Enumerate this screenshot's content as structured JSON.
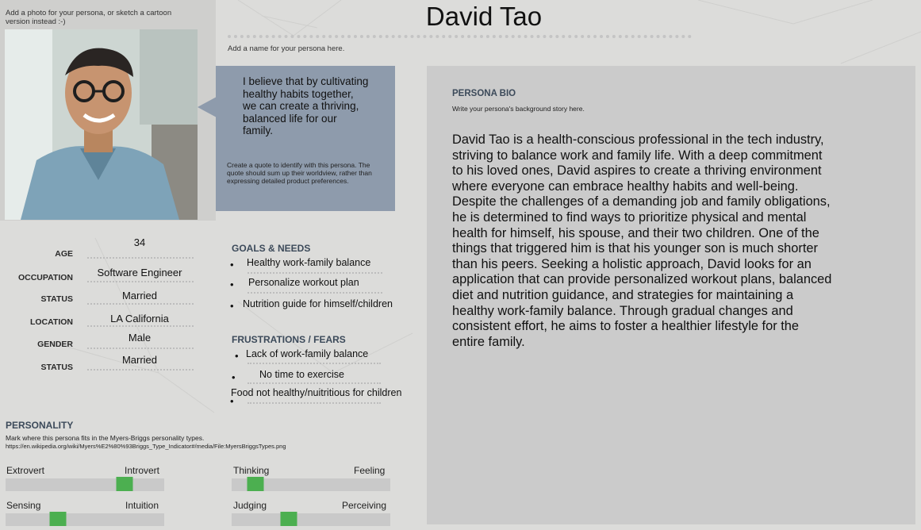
{
  "photo_hint": "Add a photo for your persona, or sketch a cartoon version instead :-)",
  "name": "David Tao",
  "name_hint": "Add a name for your persona here.",
  "quote": {
    "text": "I believe that by cultivating healthy habits together, we can create a thriving, balanced life for our family.",
    "hint": "Create a quote to identify with this persona. The quote should sum up their worldview, rather than expressing detailed product preferences."
  },
  "demographics": [
    {
      "label": "AGE",
      "value": "34"
    },
    {
      "label": "OCCUPATION",
      "value": "Software Engineer"
    },
    {
      "label": "STATUS",
      "value": "Married"
    },
    {
      "label": "LOCATION",
      "value": "LA California"
    },
    {
      "label": "GENDER",
      "value": "Male"
    },
    {
      "label": "STATUS",
      "value": "Married"
    }
  ],
  "goals": {
    "title": "GOALS & NEEDS",
    "items": [
      "Healthy work-family balance",
      "Personalize workout plan",
      "Nutrition guide for himself/children"
    ]
  },
  "frustrations": {
    "title": "FRUSTRATIONS / FEARS",
    "items": [
      "Lack of work-family balance",
      "No time to exercise",
      "Food not healthy/nuitritious for children"
    ]
  },
  "personality": {
    "title": "PERSONALITY",
    "hint": "Mark where this persona fits in the Myers-Briggs personality types.",
    "url": "https://en.wikipedia.org/wiki/Myers%E2%80%93Briggs_Type_Indicator#/media/File:MyersBriggsTypes.png",
    "scales": [
      {
        "left": "Extrovert",
        "right": "Introvert",
        "position": 0.75
      },
      {
        "left": "Thinking",
        "right": "Feeling",
        "position": 0.15
      },
      {
        "left": "Sensing",
        "right": "Intuition",
        "position": 0.33
      },
      {
        "left": "Judging",
        "right": "Perceiving",
        "position": 0.36
      }
    ]
  },
  "bio": {
    "title": "PERSONA BIO",
    "hint": "Write your persona's background story here.",
    "text": "David Tao is a health-conscious professional in the tech industry, striving to balance work and family life. With a deep commitment to his loved ones, David aspires to create a thriving environment where everyone can embrace healthy habits and well-being. Despite the challenges of a demanding job and family obligations, he is determined to find ways to prioritize physical and mental health for himself, his spouse, and their two children. One of the things that triggered him is that his younger son is much shorter than his peers. Seeking a holistic approach, David looks for an application that can provide personalized workout plans, balanced diet and nutrition guidance, and strategies for maintaining a healthy work-family balance. Through gradual changes and consistent effort, he aims to foster a healthier lifestyle for the entire family."
  },
  "colors": {
    "background": "#dcdcda",
    "quote_box": "#8e9bac",
    "bio_panel": "#cbcbcb",
    "section_title": "#3c4a5a",
    "slider_thumb": "#4caf50"
  }
}
